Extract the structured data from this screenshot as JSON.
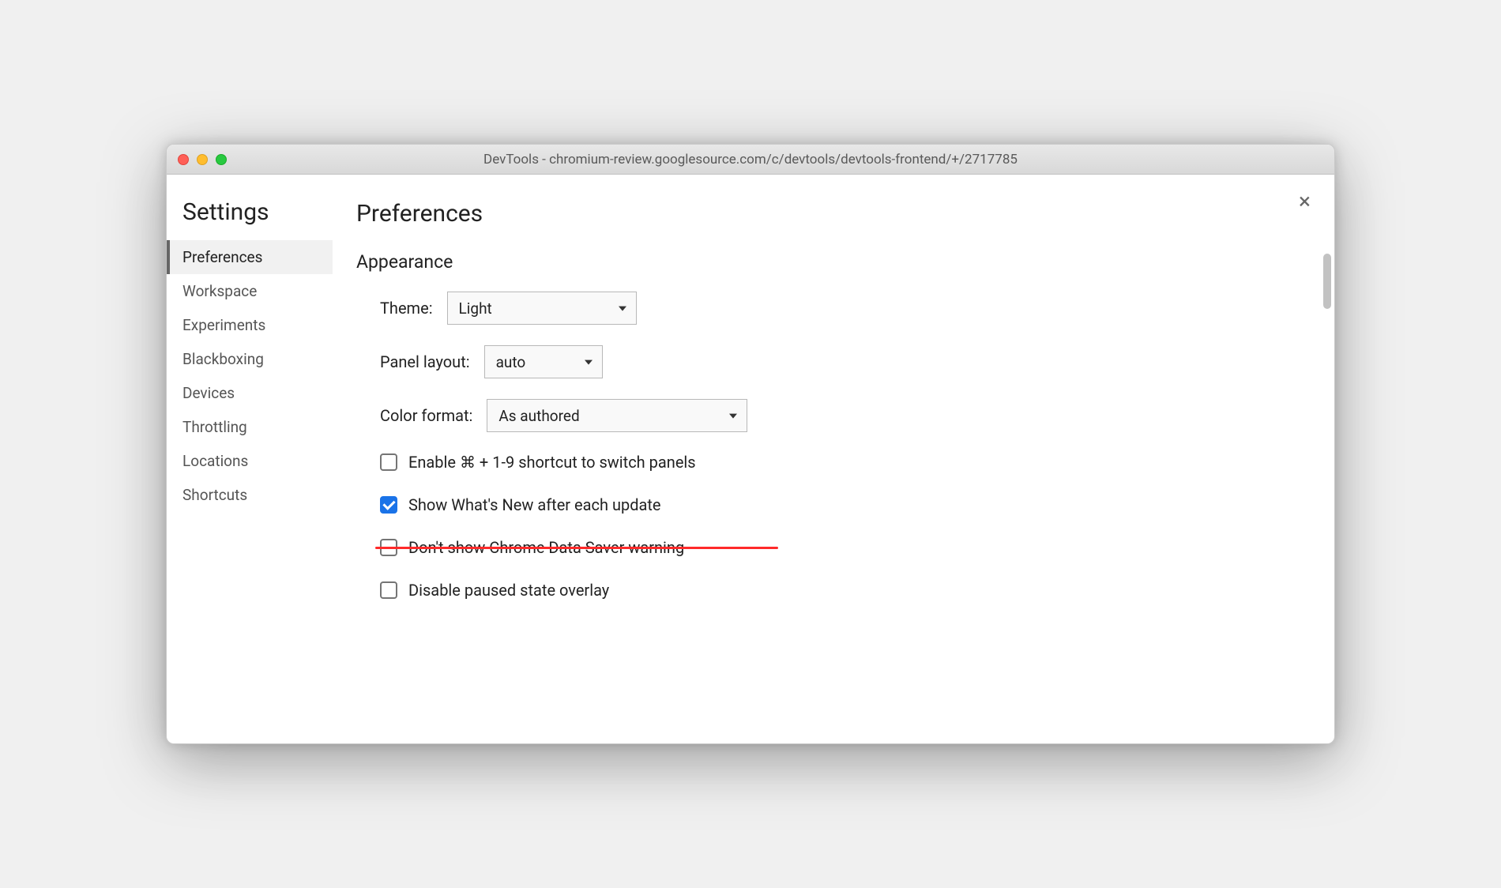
{
  "titlebar": {
    "title": "DevTools - chromium-review.googlesource.com/c/devtools/devtools-frontend/+/2717785"
  },
  "sidebar": {
    "heading": "Settings",
    "items": [
      {
        "label": "Preferences",
        "active": true
      },
      {
        "label": "Workspace"
      },
      {
        "label": "Experiments"
      },
      {
        "label": "Blackboxing"
      },
      {
        "label": "Devices"
      },
      {
        "label": "Throttling"
      },
      {
        "label": "Locations"
      },
      {
        "label": "Shortcuts"
      }
    ]
  },
  "main": {
    "heading": "Preferences",
    "section": "Appearance",
    "theme": {
      "label": "Theme:",
      "value": "Light"
    },
    "panel_layout": {
      "label": "Panel layout:",
      "value": "auto"
    },
    "color_format": {
      "label": "Color format:",
      "value": "As authored"
    },
    "checks": [
      {
        "label": "Enable ⌘ + 1-9 shortcut to switch panels",
        "checked": false,
        "struck": false
      },
      {
        "label": "Show What's New after each update",
        "checked": true,
        "struck": false
      },
      {
        "label": "Don't show Chrome Data Saver warning",
        "checked": false,
        "struck": true
      },
      {
        "label": "Disable paused state overlay",
        "checked": false,
        "struck": false
      }
    ]
  }
}
